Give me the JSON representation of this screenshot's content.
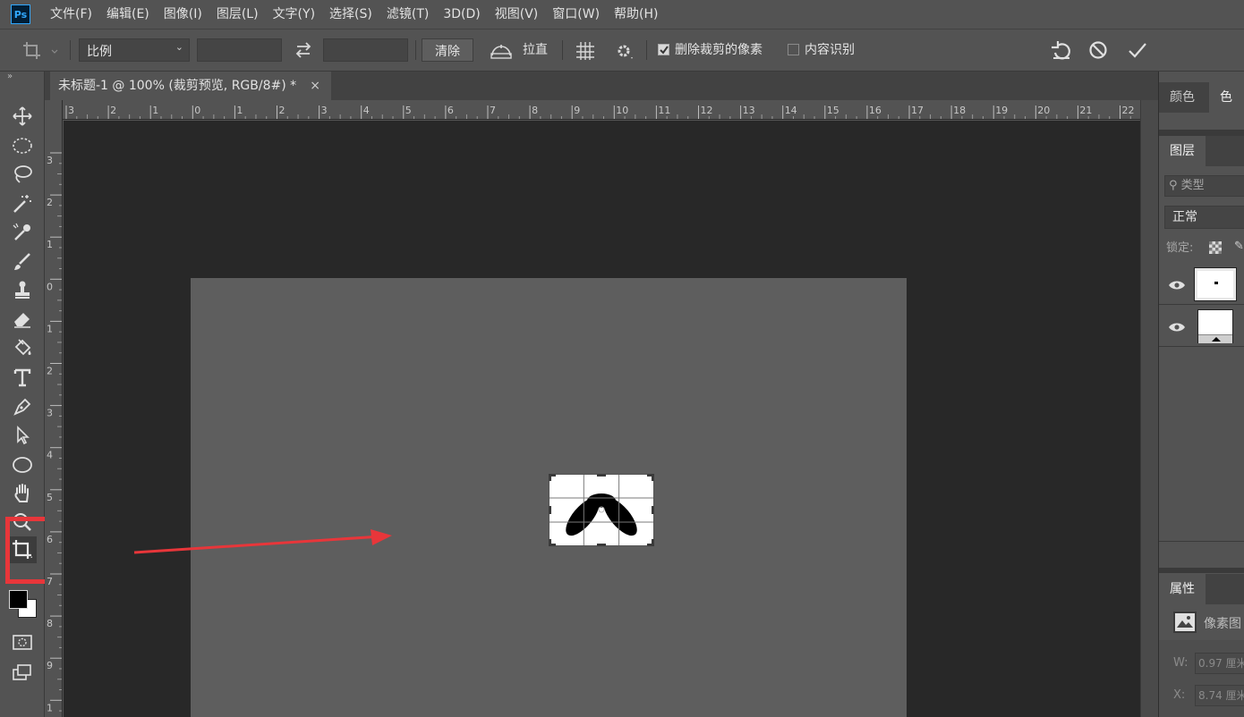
{
  "app": {
    "logo": "Ps"
  },
  "menu": [
    "文件(F)",
    "编辑(E)",
    "图像(I)",
    "图层(L)",
    "文字(Y)",
    "选择(S)",
    "滤镜(T)",
    "3D(D)",
    "视图(V)",
    "窗口(W)",
    "帮助(H)"
  ],
  "options": {
    "ratio_select": "比例",
    "width_value": "",
    "height_value": "",
    "clear_label": "清除",
    "straighten_label": "拉直",
    "delete_cropped_label": "删除裁剪的像素",
    "delete_cropped_checked": true,
    "content_aware_label": "内容识别",
    "content_aware_checked": false
  },
  "document": {
    "tab_title": "未标题-1 @ 100% (裁剪预览, RGB/8#) *",
    "close_symbol": "×"
  },
  "ruler": {
    "horizontal": [
      "3",
      "2",
      "1",
      "0",
      "1",
      "2",
      "3",
      "4",
      "5",
      "6",
      "7",
      "8",
      "9",
      "10",
      "11",
      "12",
      "13",
      "14",
      "15",
      "16",
      "17",
      "18",
      "19",
      "20",
      "21",
      "22"
    ],
    "vertical": [
      "3",
      "2",
      "1",
      "0",
      "1",
      "2",
      "3",
      "4",
      "5",
      "6",
      "7",
      "8",
      "9",
      "1"
    ]
  },
  "panels": {
    "color_tab": "颜色",
    "swatches_tab": "色板",
    "layers_tab": "图层",
    "search_placeholder": "类型",
    "blend_mode": "正常",
    "lock_label": "锁定:",
    "properties_tab": "属性",
    "properties_type": "像素图",
    "w_label": "W:",
    "w_value": "0.97 厘米",
    "x_label": "X:",
    "x_value": "8.74 厘米"
  },
  "annotation": {
    "highlight_color": "#e8363a",
    "highlighted_tool": "crop-tool"
  },
  "colors": {
    "foreground": "#000000",
    "background": "#ffffff"
  }
}
